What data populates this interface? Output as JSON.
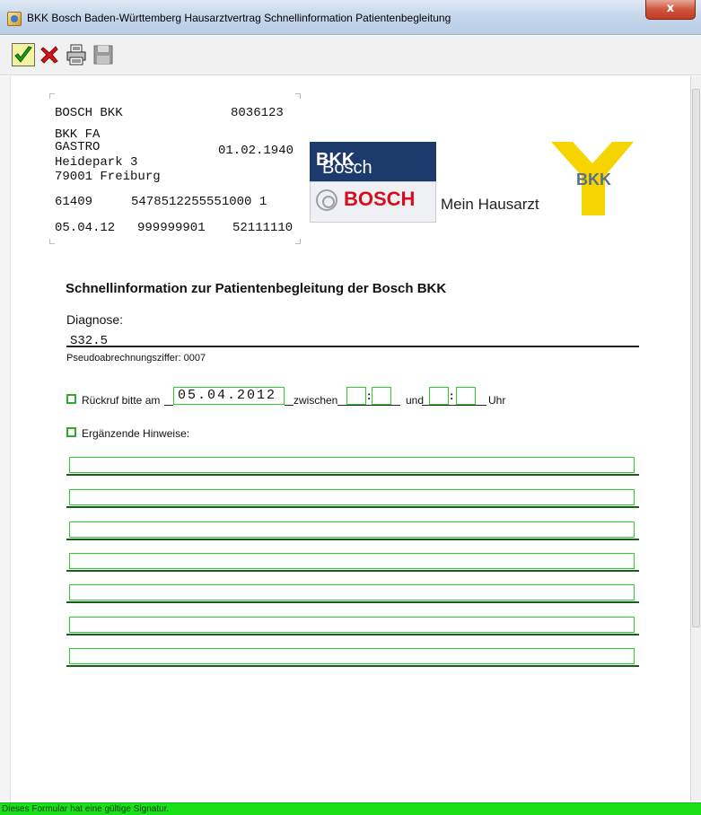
{
  "window": {
    "title": "BKK Bosch Baden-Württemberg Hausarztvertrag Schnellinformation Patientenbegleitung",
    "close_glyph": "x"
  },
  "toolbar": {
    "ok_icon": "green-checkmark-icon",
    "cancel_icon": "red-x-icon",
    "print_icon": "printer-icon",
    "save_icon": "floppy-disk-icon"
  },
  "address": {
    "kasse": "BOSCH BKK",
    "kassen_nr": "8036123",
    "name": "BKK FA",
    "vorname": "GASTRO",
    "geburtsdatum": "01.02.1940",
    "strasse": "Heidepark 3",
    "ort": "79001 Freiburg",
    "plz_code": "61409",
    "versicherten_nr": "5478512255551000 1",
    "datum": "05.04.12",
    "arzt_nr": "999999901",
    "bsnr": "52111110"
  },
  "logos": {
    "bosch_bkk_text_light": "Bosch",
    "bosch_bkk_text_bold": "BKK",
    "bosch_word": "BOSCH",
    "mein_hausarzt": "Mein Hausarzt",
    "bkk_yellow": "BKK"
  },
  "form": {
    "title": "Schnellinformation zur Patientenbegleitung der Bosch BKK",
    "diagnose_label": "Diagnose:",
    "diagnose_value": "S32.5",
    "pseudo_label": "Pseudoabrechnungsziffer: 0007",
    "rueckruf_label": "Rückruf bitte am",
    "rueckruf_date": "05.04.2012",
    "zwischen_label": "zwischen",
    "und_label": "und",
    "uhr_label": "Uhr",
    "time_colon": ":",
    "hinweise_label": "Ergänzende Hinweise:",
    "hint_lines": [
      "",
      "",
      "",
      "",
      "",
      "",
      ""
    ]
  },
  "status": {
    "text": "Dieses Formular hat eine gültige Signatur."
  },
  "colors": {
    "field_border": "#28d228",
    "status_green": "#19e019",
    "bosch_red": "#d40e1e",
    "bosch_blue": "#1d3a6d",
    "bkk_yellow": "#f5d400"
  }
}
